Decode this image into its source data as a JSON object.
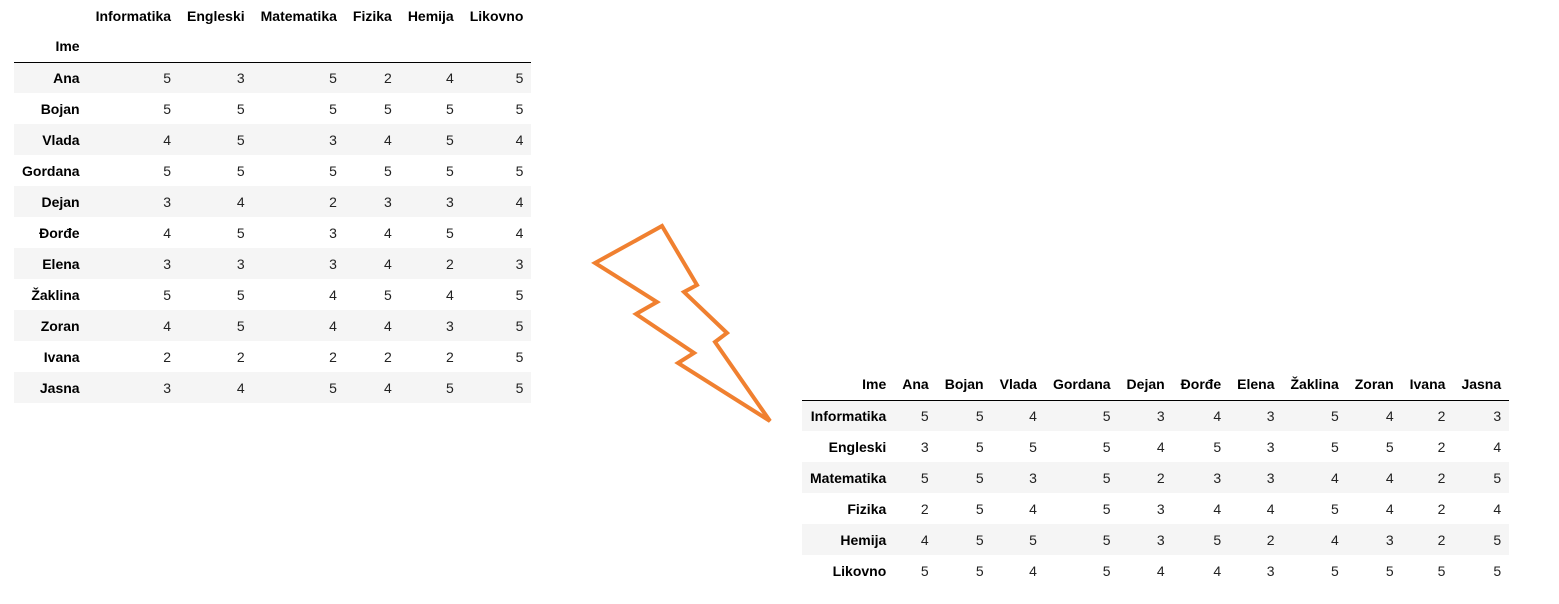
{
  "left_table": {
    "columns": [
      "Informatika",
      "Engleski",
      "Matematika",
      "Fizika",
      "Hemija",
      "Likovno"
    ],
    "index_name": "Ime",
    "rows": [
      {
        "name": "Ana",
        "values": [
          5,
          3,
          5,
          2,
          4,
          5
        ]
      },
      {
        "name": "Bojan",
        "values": [
          5,
          5,
          5,
          5,
          5,
          5
        ]
      },
      {
        "name": "Vlada",
        "values": [
          4,
          5,
          3,
          4,
          5,
          4
        ]
      },
      {
        "name": "Gordana",
        "values": [
          5,
          5,
          5,
          5,
          5,
          5
        ]
      },
      {
        "name": "Dejan",
        "values": [
          3,
          4,
          2,
          3,
          3,
          4
        ]
      },
      {
        "name": "Đorđe",
        "values": [
          4,
          5,
          3,
          4,
          5,
          4
        ]
      },
      {
        "name": "Elena",
        "values": [
          3,
          3,
          3,
          4,
          2,
          3
        ]
      },
      {
        "name": "Žaklina",
        "values": [
          5,
          5,
          4,
          5,
          4,
          5
        ]
      },
      {
        "name": "Zoran",
        "values": [
          4,
          5,
          4,
          4,
          3,
          5
        ]
      },
      {
        "name": "Ivana",
        "values": [
          2,
          2,
          2,
          2,
          2,
          5
        ]
      },
      {
        "name": "Jasna",
        "values": [
          3,
          4,
          5,
          4,
          5,
          5
        ]
      }
    ]
  },
  "right_table": {
    "index_name": "Ime",
    "columns": [
      "Ana",
      "Bojan",
      "Vlada",
      "Gordana",
      "Dejan",
      "Đorđe",
      "Elena",
      "Žaklina",
      "Zoran",
      "Ivana",
      "Jasna"
    ],
    "rows": [
      {
        "name": "Informatika",
        "values": [
          5,
          5,
          4,
          5,
          3,
          4,
          3,
          5,
          4,
          2,
          3
        ]
      },
      {
        "name": "Engleski",
        "values": [
          3,
          5,
          5,
          5,
          4,
          5,
          3,
          5,
          5,
          2,
          4
        ]
      },
      {
        "name": "Matematika",
        "values": [
          5,
          5,
          3,
          5,
          2,
          3,
          3,
          4,
          4,
          2,
          5
        ]
      },
      {
        "name": "Fizika",
        "values": [
          2,
          5,
          4,
          5,
          3,
          4,
          4,
          5,
          4,
          2,
          4
        ]
      },
      {
        "name": "Hemija",
        "values": [
          4,
          5,
          5,
          5,
          3,
          5,
          2,
          4,
          3,
          2,
          5
        ]
      },
      {
        "name": "Likovno",
        "values": [
          5,
          5,
          4,
          5,
          4,
          4,
          3,
          5,
          5,
          5,
          5
        ]
      }
    ]
  },
  "arrow": {
    "color": "#f08030",
    "icon": "lightning-bolt-arrow-icon"
  }
}
